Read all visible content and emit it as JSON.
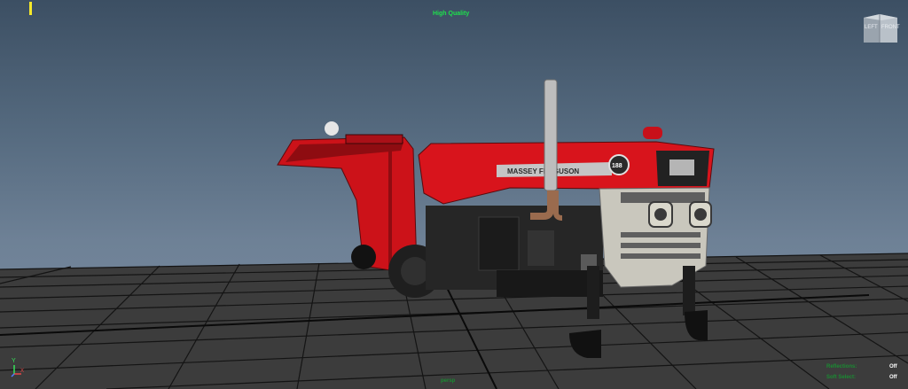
{
  "viewport": {
    "quality_label": "High Quality",
    "background_top": "#3c4f63",
    "background_bottom": "#7b8ea2"
  },
  "viewcube": {
    "left_label": "LEFT",
    "front_label": "FRONT"
  },
  "axis": {
    "y_label": "Y",
    "x_label": "X"
  },
  "model": {
    "hood_text": "MASSEY FERGUSON",
    "badge_text": "188",
    "body_color": "#d8141c",
    "grille_color": "#c9c7bd"
  },
  "hud": {
    "center_text": "persp",
    "rows": [
      {
        "name": "Reflections:",
        "value": "Off"
      },
      {
        "name": "Soft Select:",
        "value": "Off"
      }
    ]
  }
}
